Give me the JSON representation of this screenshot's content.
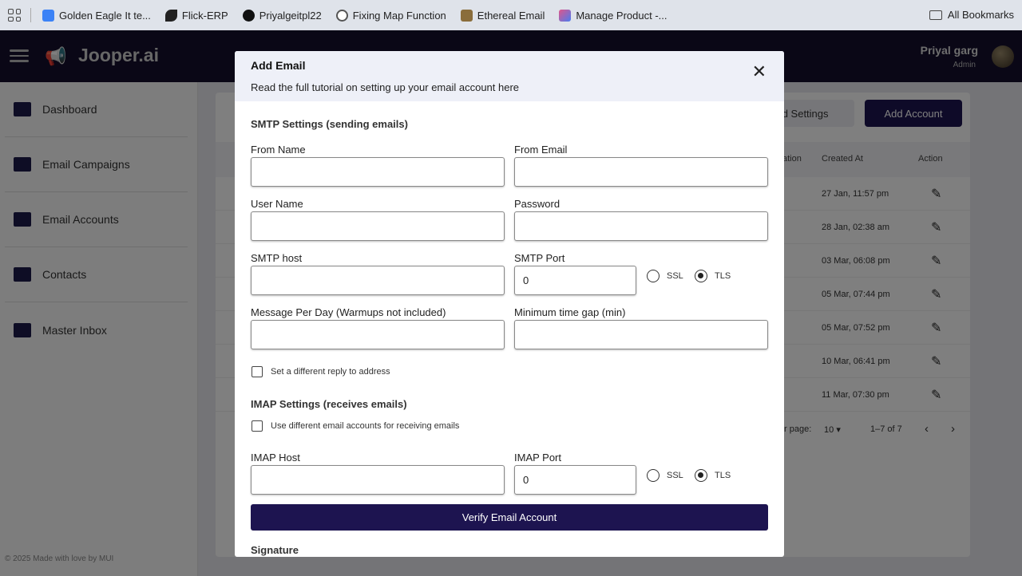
{
  "bookmarks": {
    "items": [
      {
        "label": "Golden Eagle It te...",
        "color": "#3b82f6"
      },
      {
        "label": "Flick-ERP",
        "color": "#222222"
      },
      {
        "label": "Priyalgeitpl22",
        "color": "#111111"
      },
      {
        "label": "Fixing Map Function",
        "color": "#555555"
      },
      {
        "label": "Ethereal Email",
        "color": "#8a6d3b"
      },
      {
        "label": "Manage Product -...",
        "color": "#e0568a"
      }
    ],
    "all_label": "All Bookmarks"
  },
  "header": {
    "logo": "Jooper.ai",
    "user_name": "Priyal garg",
    "user_role": "Admin"
  },
  "sidebar": {
    "items": [
      {
        "label": "Dashboard",
        "icon": "dashboard-icon"
      },
      {
        "label": "Email Campaigns",
        "icon": "megaphone-icon"
      },
      {
        "label": "Email Accounts",
        "icon": "contact-card-icon"
      },
      {
        "label": "Contacts",
        "icon": "contacts-icon"
      },
      {
        "label": "Master Inbox",
        "icon": "inbox-icon"
      }
    ],
    "footer": "© 2025 Made with love by MUI"
  },
  "main": {
    "advanced_btn": "ed Settings",
    "add_account_btn": "Add Account",
    "columns": {
      "col_a": "ation",
      "created": "Created At",
      "action": "Action"
    },
    "rows": [
      "27 Jan, 11:57 pm",
      "28 Jan, 02:38 am",
      "03 Mar, 06:08 pm",
      "05 Mar, 07:44 pm",
      "05 Mar, 07:52 pm",
      "10 Mar, 06:41 pm",
      "11 Mar, 07:30 pm"
    ],
    "pager": {
      "rows_label": "r page:",
      "rows_value": "10",
      "range": "1–7 of 7"
    }
  },
  "modal": {
    "title": "Add Email",
    "subtitle": "Read the full tutorial on setting up your email account here",
    "smtp_title": "SMTP Settings (sending emails)",
    "from_name_label": "From Name",
    "from_email_label": "From Email",
    "user_name_label": "User Name",
    "password_label": "Password",
    "smtp_host_label": "SMTP host",
    "smtp_port_label": "SMTP Port",
    "smtp_port_value": "0",
    "ssl_label": "SSL",
    "tls_label": "TLS",
    "smtp_security_selected": "TLS",
    "msg_per_day_label": "Message Per Day (Warmups not included)",
    "min_gap_label": "Minimum time gap (min)",
    "reply_to_label": "Set a different reply to address",
    "imap_title": "IMAP Settings (receives emails)",
    "diff_accounts_label": "Use different email accounts for receiving emails",
    "imap_host_label": "IMAP Host",
    "imap_port_label": "IMAP Port",
    "imap_port_value": "0",
    "imap_security_selected": "TLS",
    "verify_label": "Verify Email Account",
    "signature_title": "Signature"
  }
}
